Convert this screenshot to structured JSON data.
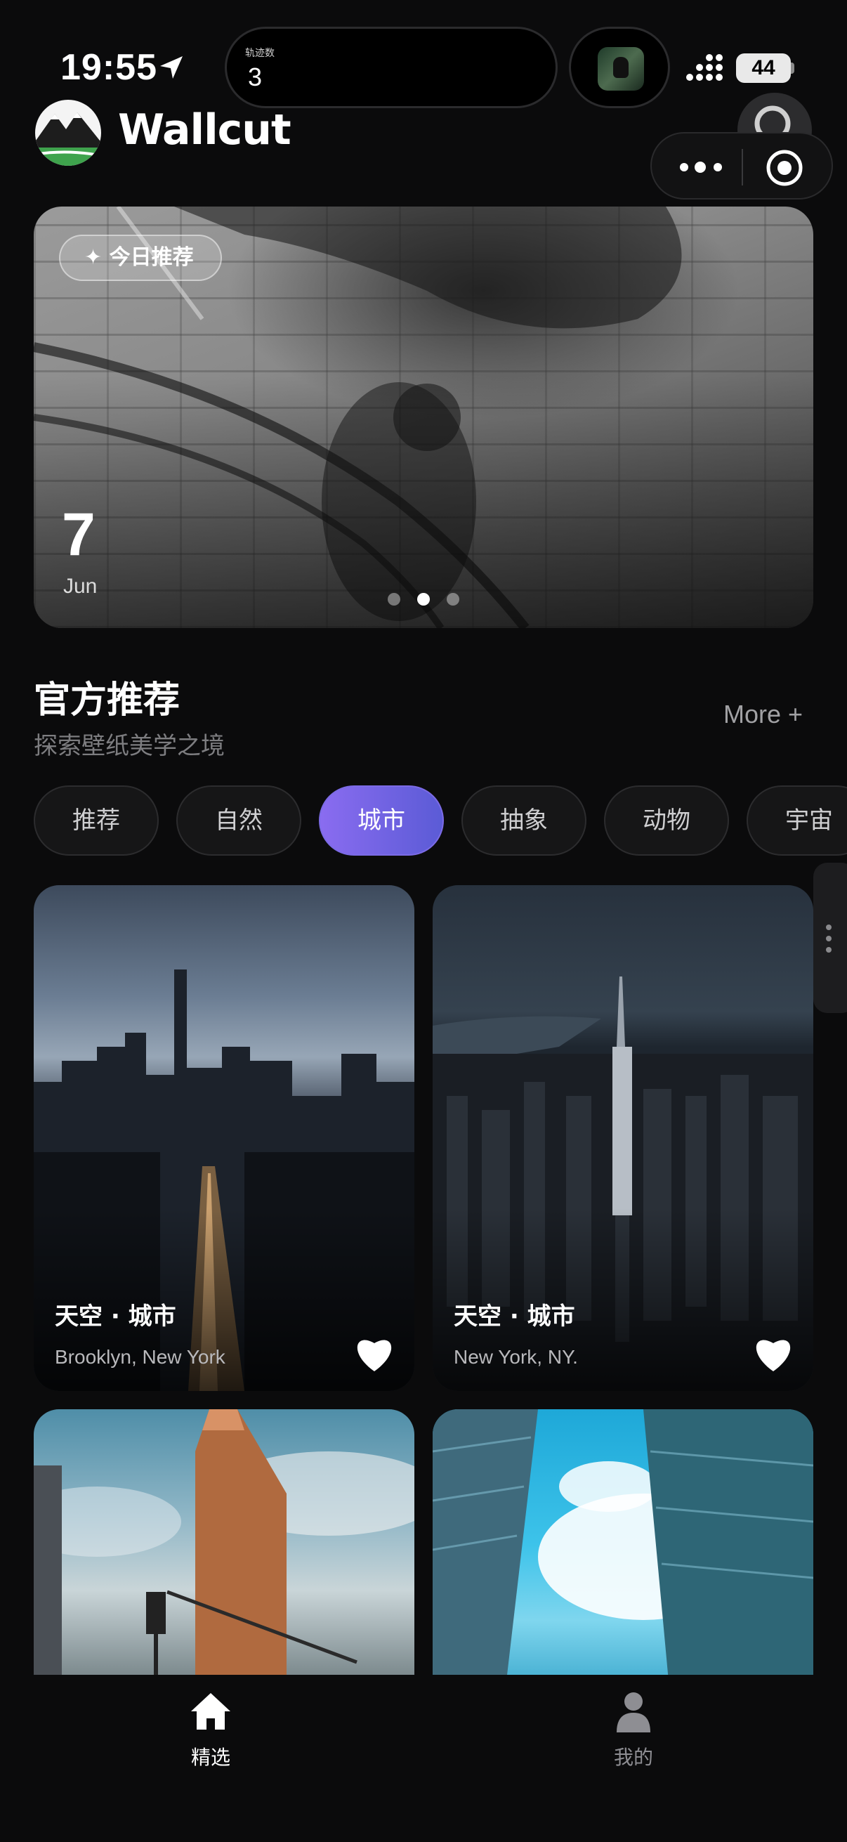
{
  "status": {
    "time": "19:55",
    "battery": "44",
    "island_label": "轨迹数",
    "island_value": "3"
  },
  "app": {
    "title": "Wallcut"
  },
  "hero": {
    "badge": "✦ 今日推荐",
    "day": "7",
    "month": "Jun",
    "slides": 3,
    "active_slide": 2
  },
  "section": {
    "title": "官方推荐",
    "subtitle": "探索壁纸美学之境",
    "more": "More +"
  },
  "categories": [
    "推荐",
    "自然",
    "城市",
    "抽象",
    "动物",
    "宇宙"
  ],
  "active_category": "城市",
  "wallpapers": [
    {
      "title": "天空 · 城市",
      "location": "Brooklyn, New York"
    },
    {
      "title": "天空 · 城市",
      "location": "New York, NY."
    }
  ],
  "tabs": {
    "home": "精选",
    "mine": "我的"
  },
  "colors": {
    "accent_start": "#8a6cf0",
    "accent_end": "#5b5bd6",
    "background": "#0b0b0c"
  }
}
